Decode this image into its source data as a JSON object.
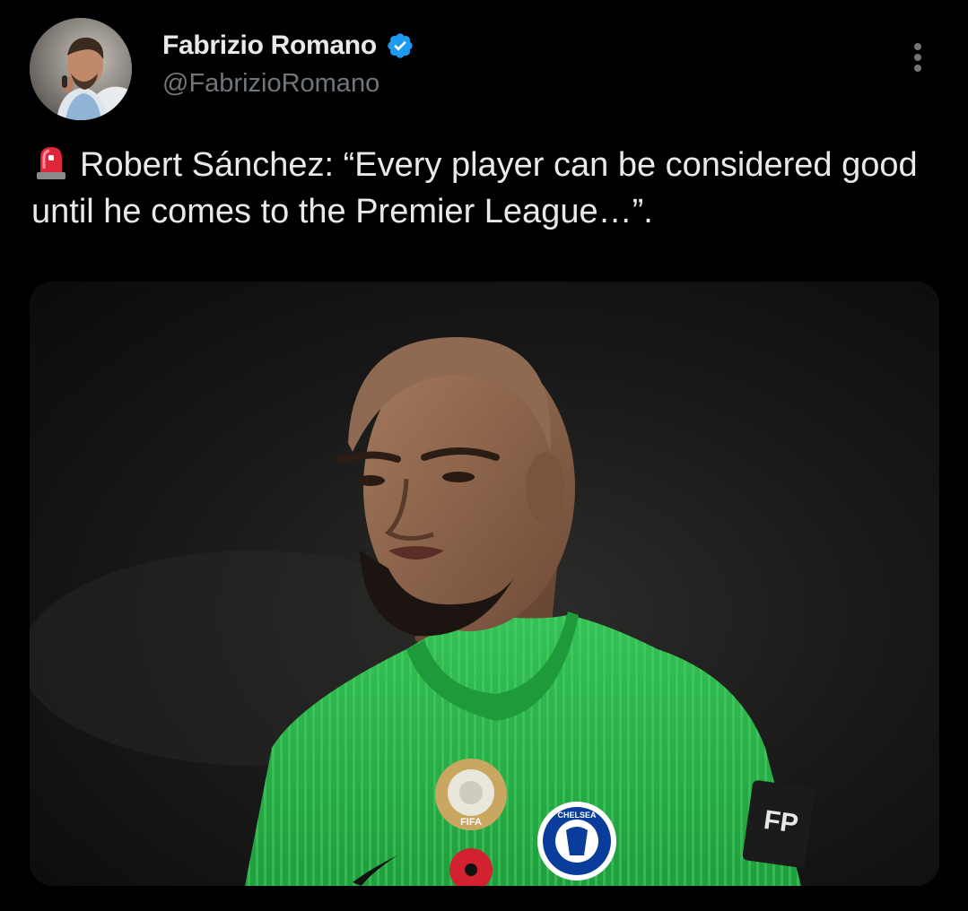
{
  "author": {
    "display_name": "Fabrizio Romano",
    "handle": "@FabrizioRomano",
    "verified": true,
    "verified_color": "#1d9bf0"
  },
  "tweet": {
    "emoji": "rotating-light-icon",
    "text": "Robert Sánchez: “Every player can be considered good until he comes to the Premier League…”."
  },
  "media": {
    "badge_text": "FIFA",
    "crest_text": "CHELSEA",
    "sponsor_text": "FP",
    "shirt_color": "#2db84a"
  }
}
